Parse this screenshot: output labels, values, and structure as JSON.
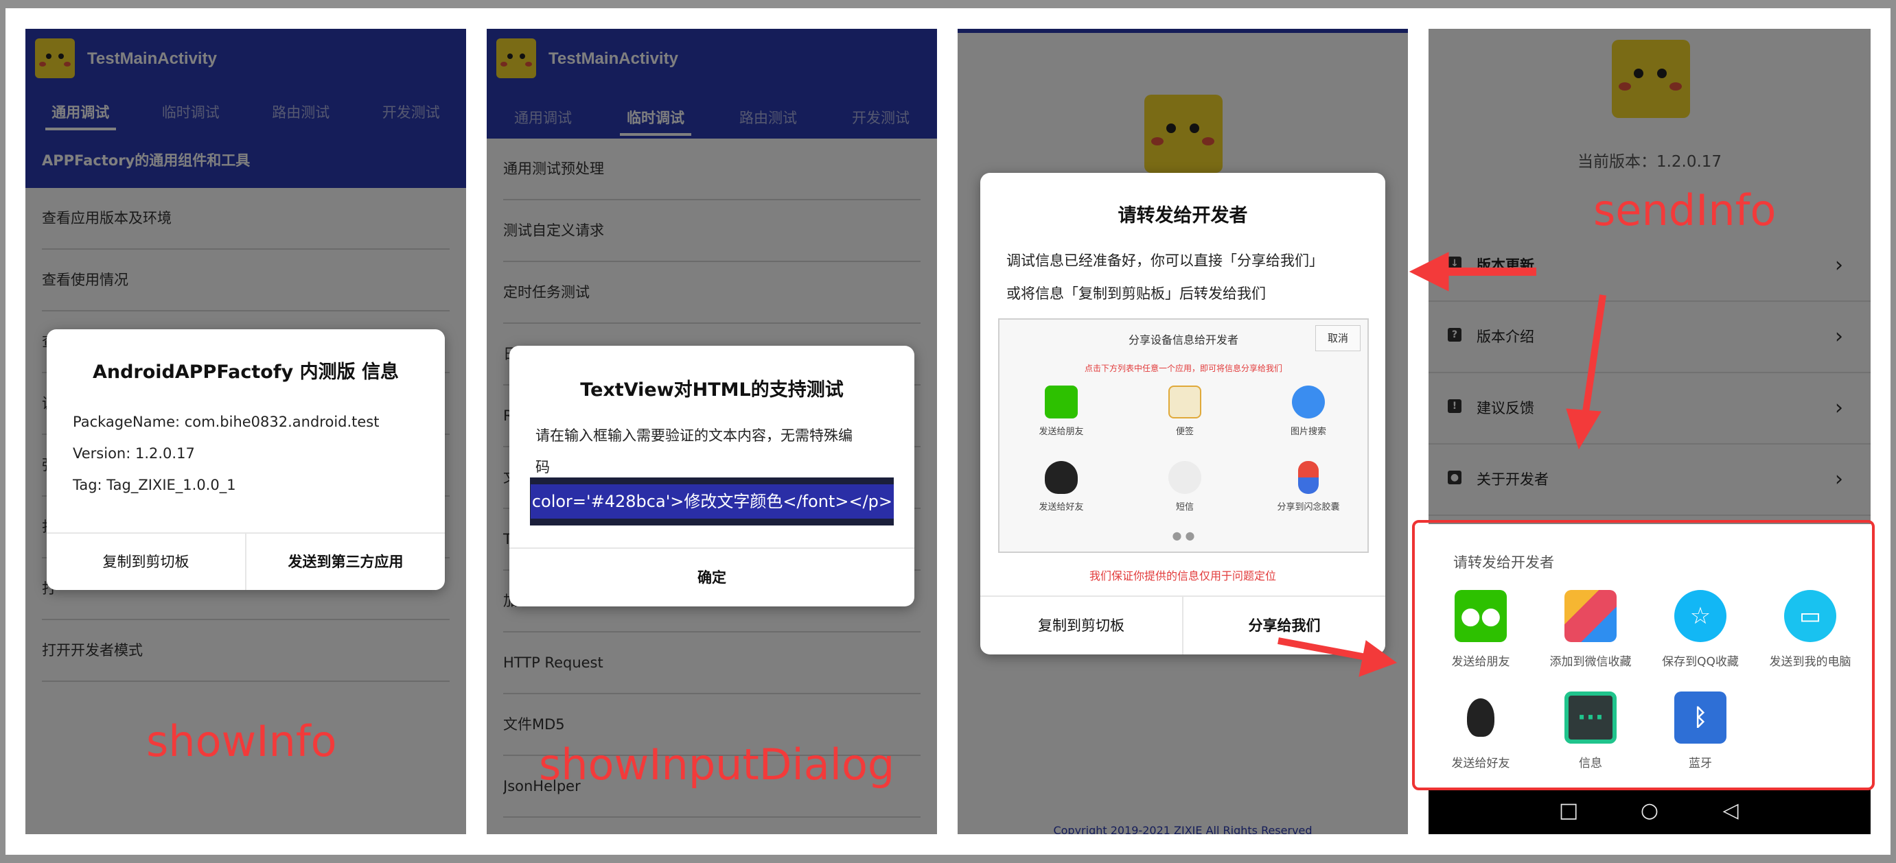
{
  "app": {
    "title": "TestMainActivity",
    "tabs": [
      "通用调试",
      "临时调试",
      "路由测试",
      "开发测试"
    ]
  },
  "panel1": {
    "subheader": "APPFactory的通用组件和工具",
    "items": [
      "查看应用版本及环境",
      "查看使用情况",
      "查",
      "调",
      "强",
      "打",
      "打",
      "打开开发者模式"
    ],
    "dialog": {
      "title_name": "AndroidAPPFactofy",
      "title_rest": " 内测版 信息",
      "lines": [
        "PackageName: com.bihe0832.android.test",
        "Version: 1.2.0.17",
        "Tag: Tag_ZIXIE_1.0.0_1"
      ],
      "btn_copy": "复制到剪切板",
      "btn_send": "发送到第三方应用"
    },
    "annotation": "showInfo"
  },
  "panel2": {
    "items": [
      "通用测试预处理",
      "测试自定义请求",
      "定时任务测试",
      "日",
      "R",
      "文",
      "T",
      "加",
      "HTTP Request",
      "文件MD5",
      "JsonHelper"
    ],
    "dialog": {
      "title": "TextView对HTML的支持测试",
      "body_line1": "请在输入框输入需要验证的文本内容，无需特殊编",
      "body_line2": "码",
      "input_value": "color='#428bca'>修改文字颜色</font></p>",
      "btn_ok": "确定"
    },
    "annotation": "showInputDialog"
  },
  "panel3": {
    "dialog": {
      "title": "请转发给开发者",
      "body_line1": "调试信息已经准备好，你可以直接「分享给我们」",
      "body_line2": "或将信息「复制到剪贴板」后转发给我们",
      "share_title": "分享设备信息给开发者",
      "share_cancel": "取消",
      "share_hint": "点击下方列表中任意一个应用，即可将信息分享给我们",
      "share_items": [
        "发送给朋友",
        "便签",
        "图片搜索",
        "发送给好友",
        "短信",
        "分享到闪念胶囊"
      ],
      "share_dots": "● ●",
      "note": "我们保证你提供的信息仅用于问题定位",
      "btn_copy": "复制到剪切板",
      "btn_share": "分享给我们"
    },
    "copyright": "Copyright 2019-2021 ZIXIE All Rights Reserved"
  },
  "panel4": {
    "version": "当前版本：1.2.0.17",
    "rows": [
      {
        "label": "版本更新",
        "icon": "update-icon"
      },
      {
        "label": "版本介绍",
        "icon": "help-icon"
      },
      {
        "label": "建议反馈",
        "icon": "feedback-icon"
      },
      {
        "label": "关于开发者",
        "icon": "account-icon"
      }
    ],
    "sheet": {
      "title": "请转发给开发者",
      "items": [
        "发送给朋友",
        "添加到微信收藏",
        "保存到QQ收藏",
        "发送到我的电脑",
        "发送给好友",
        "信息",
        "蓝牙"
      ]
    },
    "annotation": "sendInfo"
  },
  "colors": {
    "app_bar": "#2b3bb3",
    "annotation_red": "#f33a3a",
    "wechat_green": "#2dc100",
    "qq_blue": "#12b7f5"
  }
}
